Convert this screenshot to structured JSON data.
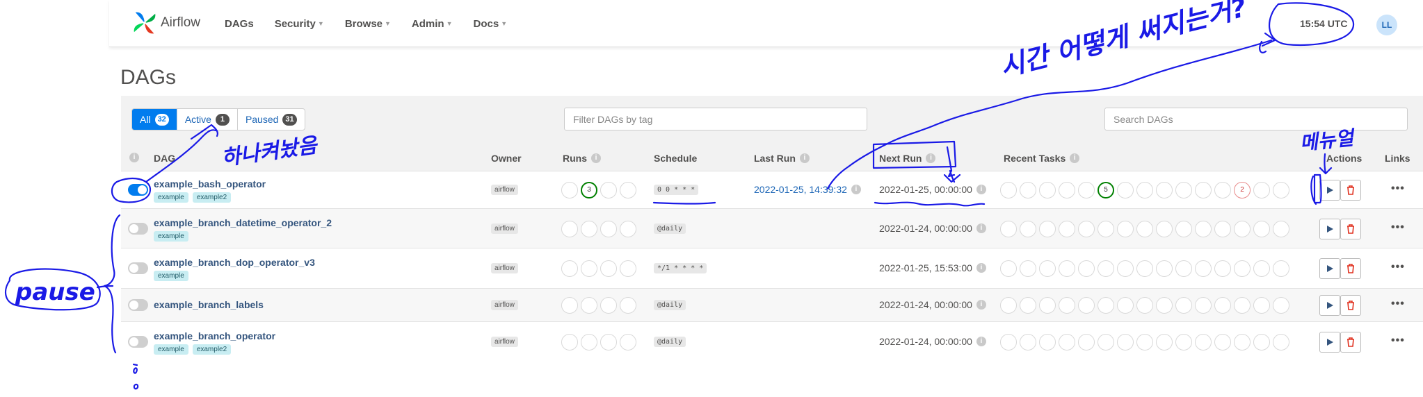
{
  "brand": {
    "name": "Airflow"
  },
  "nav": {
    "items": [
      {
        "label": "DAGs",
        "caret": false
      },
      {
        "label": "Security",
        "caret": true
      },
      {
        "label": "Browse",
        "caret": true
      },
      {
        "label": "Admin",
        "caret": true
      },
      {
        "label": "Docs",
        "caret": true
      }
    ],
    "time": "15:54 UTC",
    "avatar": "LL"
  },
  "page": {
    "title": "DAGs"
  },
  "filters": {
    "all": {
      "label": "All",
      "count": "32"
    },
    "active": {
      "label": "Active",
      "count": "1"
    },
    "paused": {
      "label": "Paused",
      "count": "31"
    },
    "tag_placeholder": "Filter DAGs by tag",
    "search_placeholder": "Search DAGs"
  },
  "columns": {
    "dag": "DAG",
    "owner": "Owner",
    "runs": "Runs",
    "schedule": "Schedule",
    "last_run": "Last Run",
    "next_run": "Next Run",
    "recent_tasks": "Recent Tasks",
    "actions": "Actions",
    "links": "Links"
  },
  "dags": [
    {
      "name": "example_bash_operator",
      "active": true,
      "tags": [
        "example",
        "example2"
      ],
      "owner": "airflow",
      "runs": [
        "",
        "3",
        "",
        ""
      ],
      "schedule": "0 0 * * *",
      "last_run": "2022-01-25, 14:39:32",
      "next_run": "2022-01-25, 00:00:00",
      "recent_tasks": [
        "",
        "",
        "",
        "",
        "",
        "5",
        "",
        "",
        "",
        "",
        "",
        "",
        "2",
        "",
        ""
      ]
    },
    {
      "name": "example_branch_datetime_operator_2",
      "active": false,
      "tags": [
        "example"
      ],
      "owner": "airflow",
      "runs": [
        "",
        "",
        "",
        ""
      ],
      "schedule": "@daily",
      "last_run": "",
      "next_run": "2022-01-24, 00:00:00",
      "recent_tasks": [
        "",
        "",
        "",
        "",
        "",
        "",
        "",
        "",
        "",
        "",
        "",
        "",
        "",
        "",
        ""
      ]
    },
    {
      "name": "example_branch_dop_operator_v3",
      "active": false,
      "tags": [
        "example"
      ],
      "owner": "airflow",
      "runs": [
        "",
        "",
        "",
        ""
      ],
      "schedule": "*/1 * * * *",
      "last_run": "",
      "next_run": "2022-01-25, 15:53:00",
      "recent_tasks": [
        "",
        "",
        "",
        "",
        "",
        "",
        "",
        "",
        "",
        "",
        "",
        "",
        "",
        "",
        ""
      ]
    },
    {
      "name": "example_branch_labels",
      "active": false,
      "tags": [],
      "owner": "airflow",
      "runs": [
        "",
        "",
        "",
        ""
      ],
      "schedule": "@daily",
      "last_run": "",
      "next_run": "2022-01-24, 00:00:00",
      "recent_tasks": [
        "",
        "",
        "",
        "",
        "",
        "",
        "",
        "",
        "",
        "",
        "",
        "",
        "",
        "",
        ""
      ]
    },
    {
      "name": "example_branch_operator",
      "active": false,
      "tags": [
        "example",
        "example2"
      ],
      "owner": "airflow",
      "runs": [
        "",
        "",
        "",
        ""
      ],
      "schedule": "@daily",
      "last_run": "",
      "next_run": "2022-01-24, 00:00:00",
      "recent_tasks": [
        "",
        "",
        "",
        "",
        "",
        "",
        "",
        "",
        "",
        "",
        "",
        "",
        "",
        "",
        ""
      ]
    }
  ],
  "annotations": {
    "time_note": "시간 어떻게 써지는거?",
    "toggle_note": "하나켜놨음",
    "pause_note": "pause",
    "actions_note": "메뉴얼",
    "annotation_color": "#1a1ae6"
  }
}
